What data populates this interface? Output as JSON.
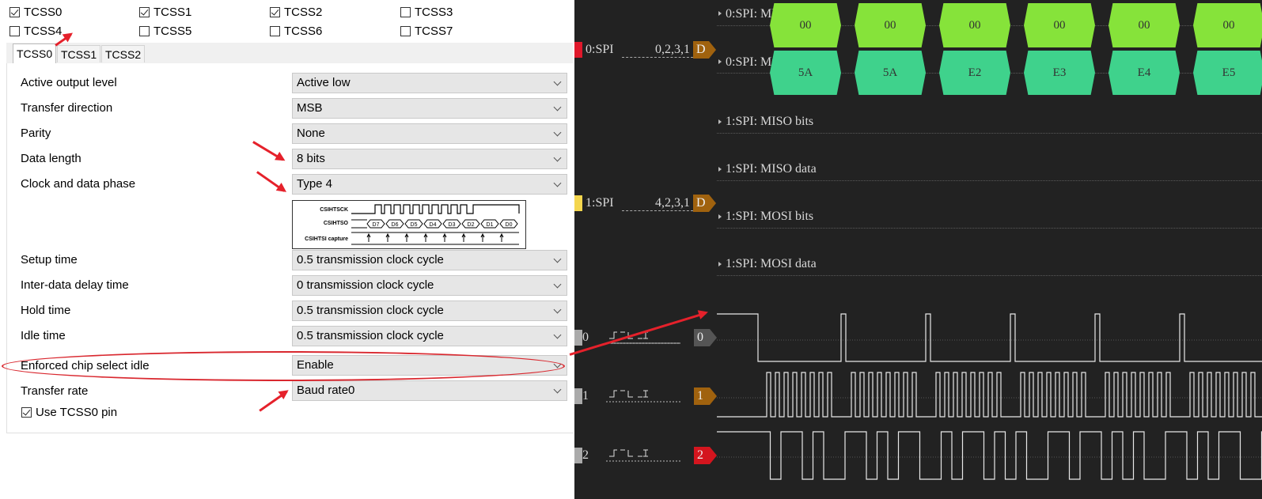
{
  "checkboxes": [
    {
      "label": "TCSS0",
      "checked": true
    },
    {
      "label": "TCSS1",
      "checked": true
    },
    {
      "label": "TCSS2",
      "checked": true
    },
    {
      "label": "TCSS3",
      "checked": false
    },
    {
      "label": "TCSS4",
      "checked": false
    },
    {
      "label": "TCSS5",
      "checked": false
    },
    {
      "label": "TCSS6",
      "checked": false
    },
    {
      "label": "TCSS7",
      "checked": false
    }
  ],
  "tabs": [
    "TCSS0",
    "TCSS1",
    "TCSS2"
  ],
  "form": {
    "active_output_level": {
      "label": "Active output level",
      "value": "Active low"
    },
    "transfer_direction": {
      "label": "Transfer direction",
      "value": "MSB"
    },
    "parity": {
      "label": "Parity",
      "value": "None"
    },
    "data_length": {
      "label": "Data length",
      "value": "8 bits"
    },
    "clock_phase": {
      "label": "Clock and data phase",
      "value": "Type 4"
    },
    "setup_time": {
      "label": "Setup time",
      "value": "0.5 transmission clock cycle"
    },
    "inter_data_delay": {
      "label": "Inter-data delay time",
      "value": "0 transmission clock cycle"
    },
    "hold_time": {
      "label": "Hold time",
      "value": "0.5 transmission clock cycle"
    },
    "idle_time": {
      "label": "Idle time",
      "value": "0.5 transmission clock cycle"
    },
    "enforced_cs_idle": {
      "label": "Enforced chip select idle",
      "value": "Enable"
    },
    "transfer_rate": {
      "label": "Transfer rate",
      "value": "Baud rate0"
    },
    "use_pin": {
      "label": "Use TCSS0 pin",
      "checked": true
    }
  },
  "timing_diagram": {
    "sck_label": "CSIHTSCK",
    "so_label": "CSIHTSO",
    "si_label": "CSIHTSI capture",
    "bits": [
      "D7",
      "D6",
      "D5",
      "D4",
      "D3",
      "D2",
      "D1",
      "D0"
    ]
  },
  "analyzer": {
    "spi0": {
      "name": "0:SPI",
      "channels": "0,2,3,1",
      "tag": "D",
      "color": "#e0182b"
    },
    "spi1": {
      "name": "1:SPI",
      "channels": "4,2,3,1",
      "tag": "D",
      "color": "#f4d64e"
    },
    "rows": [
      "0:SPI: MISO bits",
      "0:SPI: MOSI data",
      "1:SPI: MISO bits",
      "1:SPI: MISO data",
      "1:SPI: MOSI bits",
      "1:SPI: MOSI data"
    ],
    "miso_values": [
      "00",
      "00",
      "00",
      "00",
      "00",
      "00"
    ],
    "mosi_values": [
      "5A",
      "5A",
      "E2",
      "E3",
      "E4",
      "E5"
    ],
    "digital": [
      {
        "index": "0",
        "tag": "0",
        "tag_color": "#555555"
      },
      {
        "index": "1",
        "tag": "1",
        "tag_color": "#a0620e"
      },
      {
        "index": "2",
        "tag": "2",
        "tag_color": "#d4151e"
      }
    ],
    "colors": {
      "miso": "#86e33a",
      "mosi": "#3fd28c",
      "bg": "#222222"
    }
  }
}
